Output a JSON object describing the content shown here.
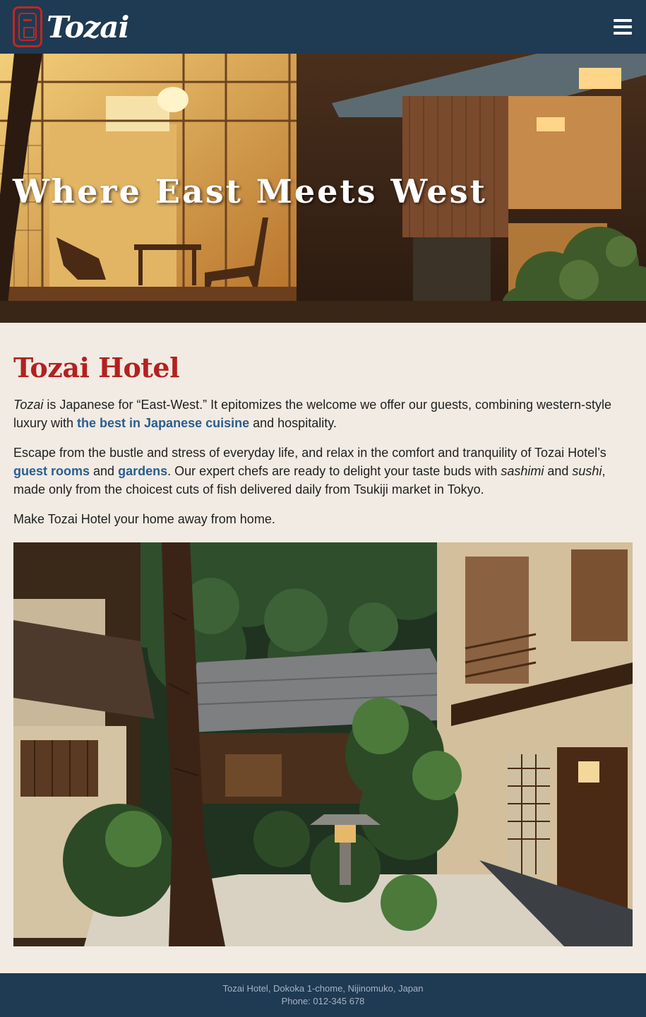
{
  "header": {
    "logo_text": "Tozai",
    "menu_icon": "hamburger-menu-icon"
  },
  "hero": {
    "title": "Where East Meets West"
  },
  "main": {
    "title": "Tozai Hotel",
    "p1": {
      "em": "Tozai",
      "t1": " is Japanese for “East-West.” It epitomizes the welcome we offer our guests, combining western-style luxury with ",
      "link": "the best in Japanese cuisine",
      "t2": " and hospitality."
    },
    "p2": {
      "t1": "Escape from the bustle and stress of everyday life, and relax in the comfort and tranquility of Tozai Hotel’s ",
      "link1": "guest rooms",
      "t2": " and ",
      "link2": "gardens",
      "t3": ". Our expert chefs are ready to delight your taste buds with ",
      "em1": "sashimi",
      "t4": " and ",
      "em2": "sushi",
      "t5": ", made only from the choicest cuts of fish delivered daily from Tsukiji market in Tokyo."
    },
    "p3": "Make Tozai Hotel your home away from home."
  },
  "footer": {
    "address": "Tozai Hotel, Dokoka 1-chome, Nijinomuko, Japan",
    "phone": "Phone: 012-345 678"
  },
  "colors": {
    "nav_bg": "#1f3a53",
    "page_bg": "#f1ebe3",
    "title_red": "#b3211f",
    "link_blue": "#2a5d91"
  }
}
